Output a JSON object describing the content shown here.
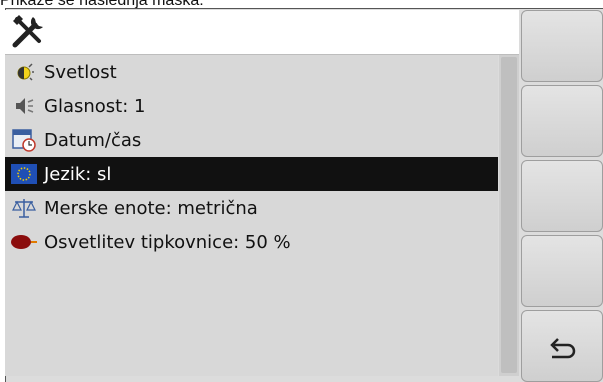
{
  "caption": "Prikaže se naslednja maska:",
  "header": {
    "icon": "tools-icon"
  },
  "menu": {
    "items": [
      {
        "label": "Svetlost",
        "icon": "brightness-icon",
        "selected": false
      },
      {
        "label": "Glasnost: 1",
        "icon": "volume-icon",
        "selected": false
      },
      {
        "label": "Datum/čas",
        "icon": "calendar-clock-icon",
        "selected": false
      },
      {
        "label": "Jezik: sl",
        "icon": "eu-flag-icon",
        "selected": true
      },
      {
        "label": "Merske enote: metrična",
        "icon": "scales-icon",
        "selected": false
      },
      {
        "label": "Osvetlitev tipkovnice:  50 %",
        "icon": "keyboard-light-icon",
        "selected": false
      }
    ]
  },
  "softkeys": {
    "back_icon": "back-icon"
  },
  "colors": {
    "selection": "#111111",
    "background": "#d8d8d8"
  }
}
